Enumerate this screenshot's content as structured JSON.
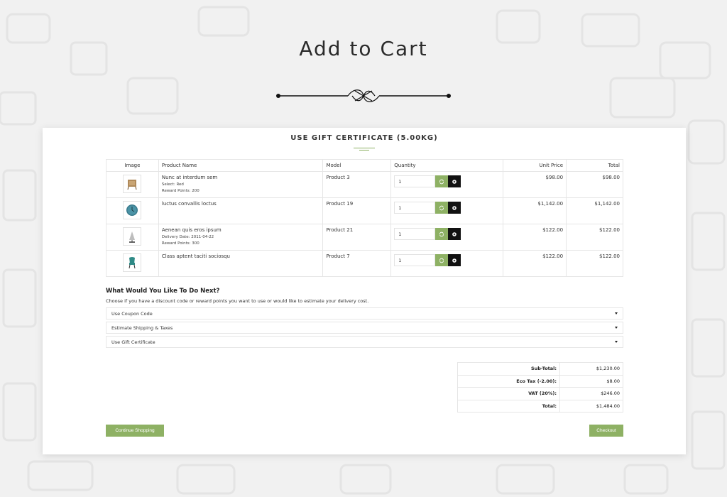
{
  "hero": {
    "title": "Add to Cart"
  },
  "panel": {
    "title": "USE GIFT CERTIFICATE  (5.00KG)"
  },
  "table": {
    "headers": [
      "Image",
      "Product Name",
      "Model",
      "Quantity",
      "Unit Price",
      "Total"
    ],
    "rows": [
      {
        "name": "Nunc at interdum sem",
        "options": [
          "Select: Red",
          "Reward Points: 200"
        ],
        "model": "Product 3",
        "qty": "1",
        "unit_price": "$98.00",
        "total": "$98.00",
        "image_icon": "cabinet-icon"
      },
      {
        "name": "luctus convallis loctus",
        "options": [],
        "model": "Product 19",
        "qty": "1",
        "unit_price": "$1,142.00",
        "total": "$1,142.00",
        "image_icon": "wall-clock-icon"
      },
      {
        "name": "Aenean quis eros ipsum",
        "options": [
          "Delivery Date: 2011-04-22",
          "Reward Points: 300"
        ],
        "model": "Product 21",
        "qty": "1",
        "unit_price": "$122.00",
        "total": "$122.00",
        "image_icon": "lamp-icon"
      },
      {
        "name": "Class aptent taciti sociosqu",
        "options": [],
        "model": "Product 7",
        "qty": "1",
        "unit_price": "$122.00",
        "total": "$122.00",
        "image_icon": "chair-icon"
      }
    ]
  },
  "next": {
    "title": "What Would You Like To Do Next?",
    "description": "Choose if you have a discount code or reward points you want to use or would like to estimate your delivery cost.",
    "items": [
      "Use Coupon Code",
      "Estimate Shipping & Taxes",
      "Use Gift Certificate"
    ]
  },
  "totals": [
    {
      "label": "Sub-Total:",
      "value": "$1,230.00"
    },
    {
      "label": "Eco Tax (-2.00):",
      "value": "$8.00"
    },
    {
      "label": "VAT (20%):",
      "value": "$246.00"
    },
    {
      "label": "Total:",
      "value": "$1,484.00"
    }
  ],
  "buttons": {
    "continue": "Continue Shopping",
    "checkout": "Checkout"
  },
  "colors": {
    "accent": "#8eb164",
    "remove": "#111111",
    "background": "#f1f1f1"
  }
}
